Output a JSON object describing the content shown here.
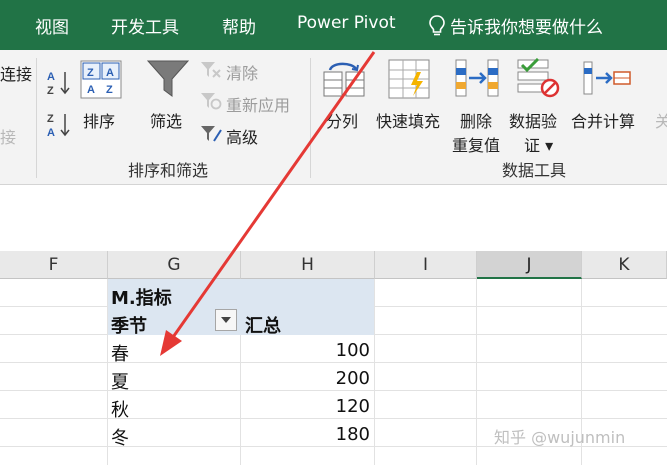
{
  "menu": {
    "tabs": [
      "视图",
      "开发工具",
      "帮助",
      "Power Pivot"
    ],
    "tell_me": "告诉我你想要做什么"
  },
  "ribbon": {
    "left_cutoff": "连接",
    "left_cutoff_dim": "接",
    "sort_filter": {
      "sort": "排序",
      "filter": "筛选",
      "clear": "清除",
      "reapply": "重新应用",
      "advanced": "高级",
      "group_label": "排序和筛选"
    },
    "data_tools": {
      "text_to_columns": "分列",
      "flash_fill": "快速填充",
      "remove_duplicates": [
        "删除",
        "重复值"
      ],
      "data_validation": [
        "数据验",
        "证 ▾"
      ],
      "consolidate": "合并计算",
      "relationships_cut": "关",
      "group_label": "数据工具"
    }
  },
  "columns": [
    "F",
    "G",
    "H",
    "I",
    "J",
    "K"
  ],
  "pivot": {
    "measure_label": "M.指标",
    "row_header": "季节",
    "value_header": "汇总",
    "rows": [
      {
        "label": "春",
        "value": "100"
      },
      {
        "label": "夏",
        "value": "200"
      },
      {
        "label": "秋",
        "value": "120"
      },
      {
        "label": "冬",
        "value": "180"
      }
    ]
  },
  "watermark": "知乎 @wujunmin",
  "colors": {
    "excel_green": "#217346",
    "pivot_header": "#dce6f1",
    "arrow": "#e53935"
  }
}
